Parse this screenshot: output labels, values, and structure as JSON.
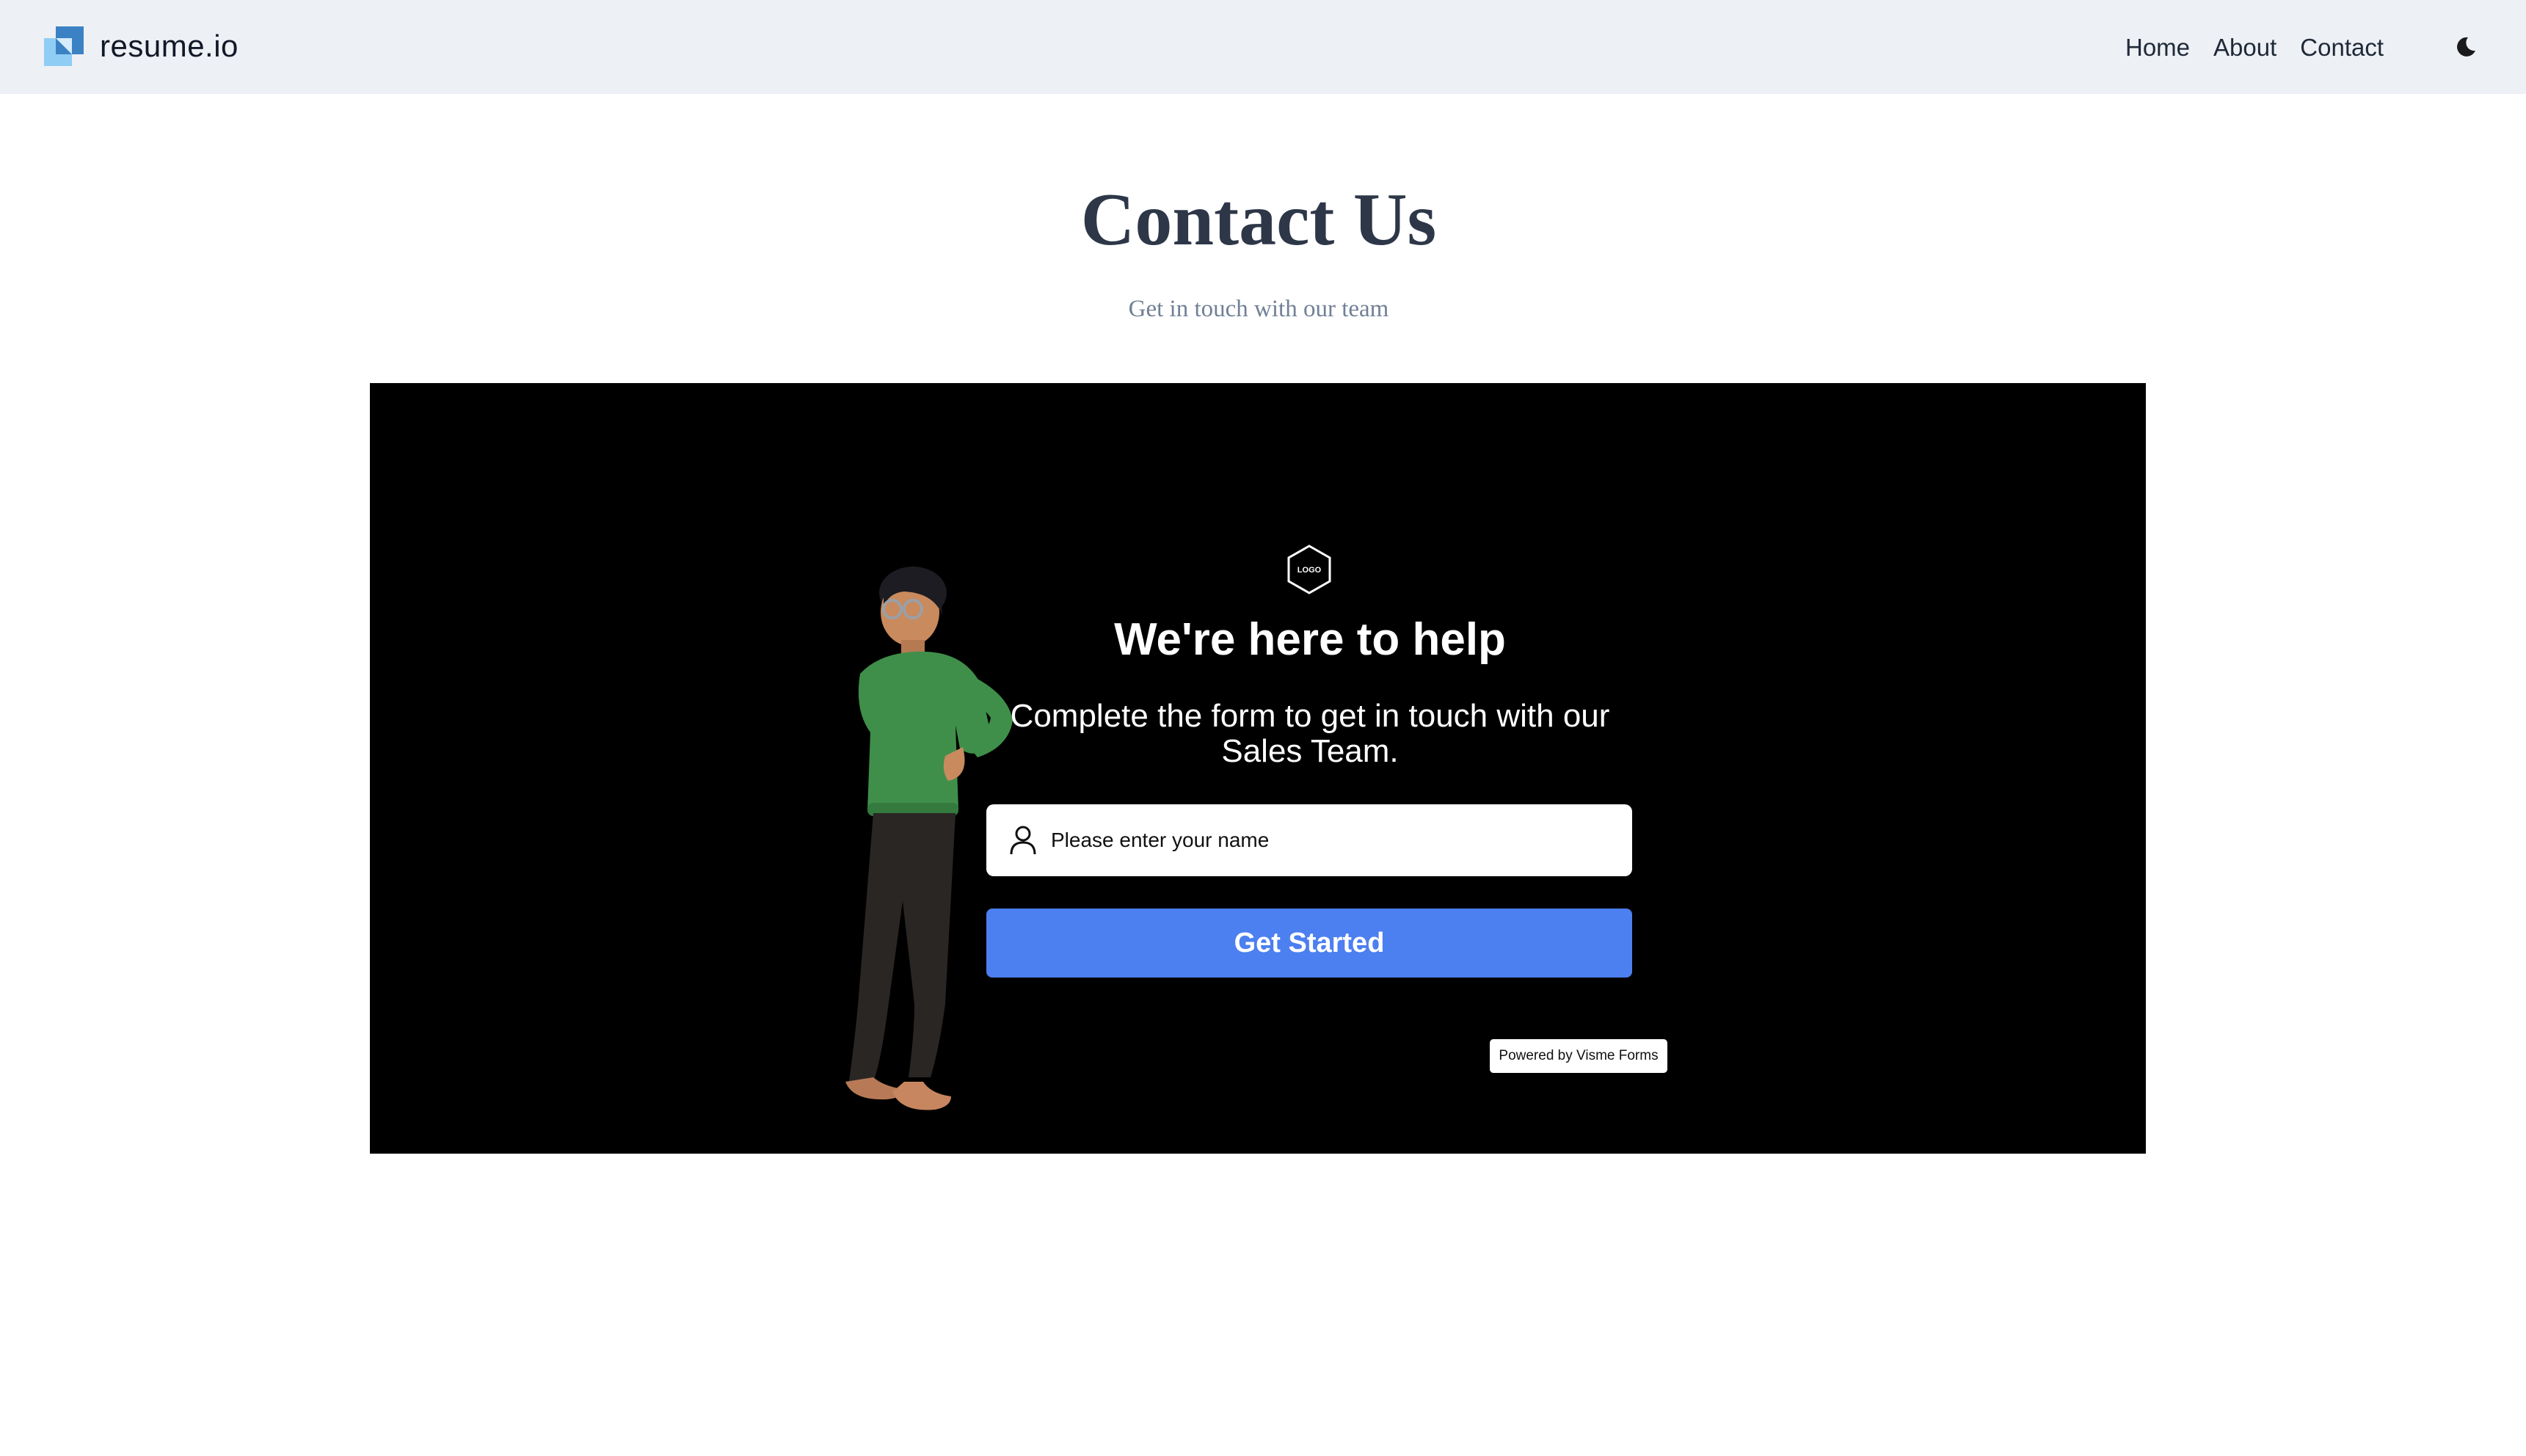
{
  "header": {
    "brand_name": "resume.io",
    "nav": [
      {
        "label": "Home"
      },
      {
        "label": "About"
      },
      {
        "label": "Contact"
      }
    ],
    "theme_toggle_icon": "moon-icon"
  },
  "page": {
    "title": "Contact Us",
    "subtitle": "Get in touch with our team"
  },
  "form": {
    "logo_text": "LOGO",
    "heading": "We're here to help",
    "description": "Complete the form to get in touch with our Sales Team.",
    "name_placeholder": "Please enter your name",
    "name_icon": "person-icon",
    "submit_label": "Get Started",
    "powered_by": "Powered by Visme Forms",
    "colors": {
      "background": "#000000",
      "button": "#4c7ff0",
      "text": "#ffffff"
    }
  },
  "colors": {
    "navbar_bg": "#edf0f5",
    "title": "#2d3748",
    "subtitle": "#718096",
    "brand_blue": "#3b82c4",
    "brand_light": "#90cdf4"
  }
}
